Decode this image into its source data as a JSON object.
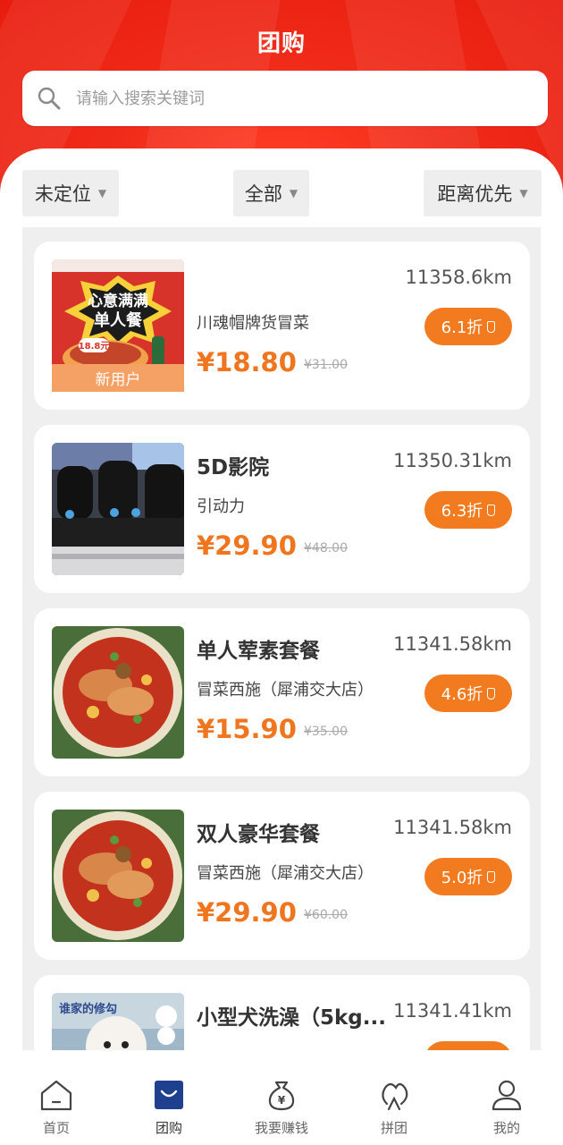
{
  "header": {
    "title": "团购"
  },
  "search": {
    "placeholder": "请输入搜索关键词"
  },
  "filters": {
    "location": "未定位",
    "category": "全部",
    "sort": "距离优先"
  },
  "deals": [
    {
      "name": "",
      "shop": "川魂帽牌货冒菜",
      "price": "¥18.80",
      "original_price": "¥31.00",
      "distance": "11358.6km",
      "discount": "6.1折",
      "badge": "新用户",
      "image": "poster-single-meal",
      "image_text": [
        "心意满满",
        "单人餐",
        "18.8元"
      ]
    },
    {
      "name": "5D影院",
      "shop": "引动力",
      "price": "¥29.90",
      "original_price": "¥48.00",
      "distance": "11350.31km",
      "discount": "6.3折",
      "image": "cinema-seats"
    },
    {
      "name": "单人荤素套餐",
      "shop": "冒菜西施（犀浦交大店）",
      "price": "¥15.90",
      "original_price": "¥35.00",
      "distance": "11341.58km",
      "discount": "4.6折",
      "image": "spicy-hotpot-bowl"
    },
    {
      "name": "双人豪华套餐",
      "shop": "冒菜西施（犀浦交大店）",
      "price": "¥29.90",
      "original_price": "¥60.00",
      "distance": "11341.58km",
      "discount": "5.0折",
      "image": "spicy-hotpot-bowl"
    },
    {
      "name": "小型犬洗澡（5kg...",
      "shop": "",
      "price": "",
      "original_price": "",
      "distance": "11341.41km",
      "discount": "",
      "image": "dog-grooming",
      "image_text": [
        "谁家的修勾"
      ]
    }
  ],
  "tabbar": [
    {
      "label": "首页",
      "icon": "home-icon"
    },
    {
      "label": "团购",
      "icon": "shopping-bag-icon",
      "active": true
    },
    {
      "label": "我要赚钱",
      "icon": "money-bag-icon"
    },
    {
      "label": "拼团",
      "icon": "group-icon"
    },
    {
      "label": "我的",
      "icon": "user-icon"
    }
  ],
  "colors": {
    "header_red": "#f02a18",
    "accent_orange": "#f27a1f",
    "price_orange": "#f0751f",
    "active_tab_blue": "#1f3f8f"
  }
}
